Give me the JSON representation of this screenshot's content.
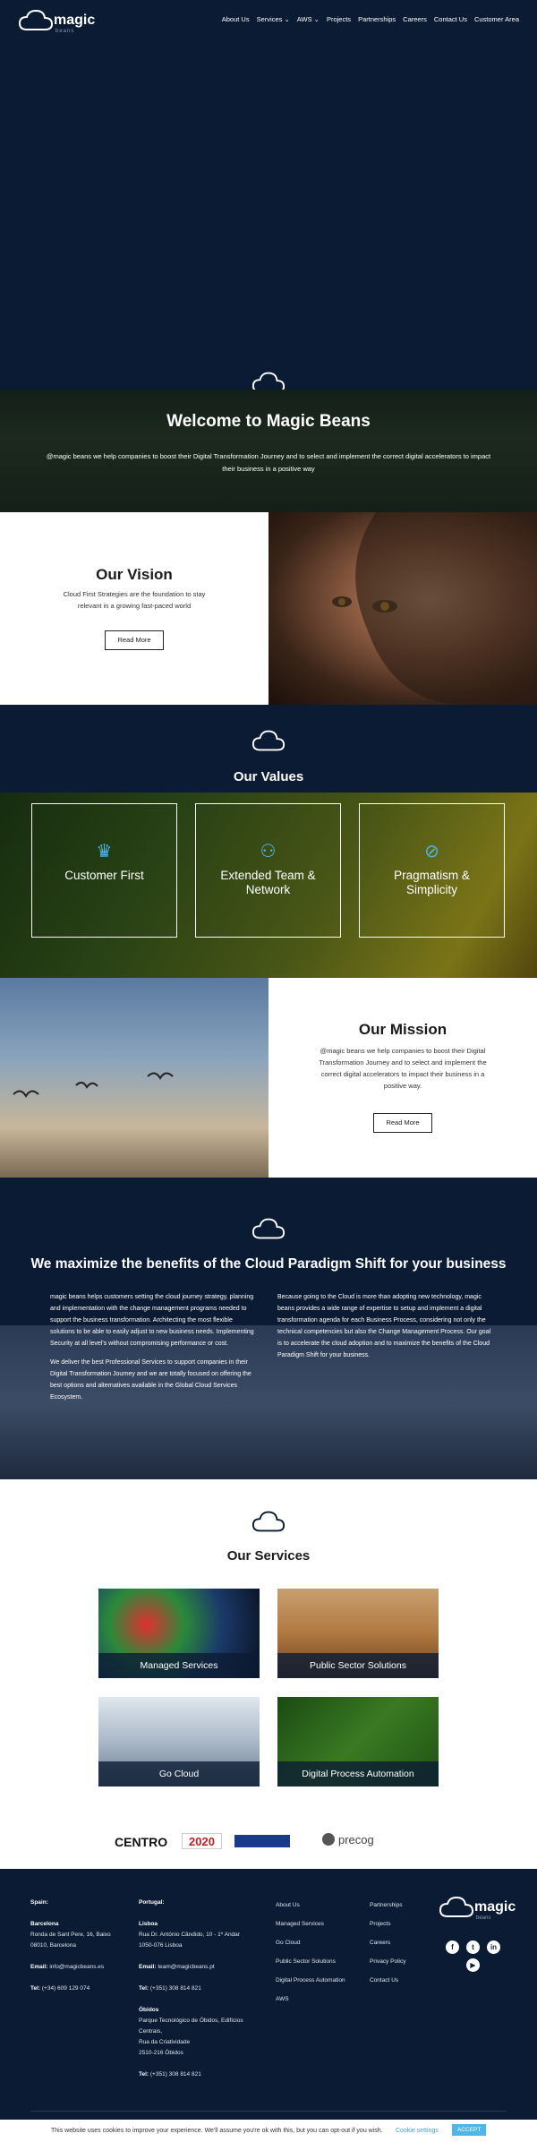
{
  "header": {
    "logo_word": "magic",
    "logo_sub": "beans",
    "nav": [
      "About Us",
      "Services",
      "AWS",
      "Projects",
      "Partnerships",
      "Careers",
      "Contact Us",
      "Customer Area"
    ]
  },
  "welcome": {
    "title": "Welcome to Magic Beans",
    "text": "@magic beans we help companies to boost their Digital Transformation Journey and to select and implement the correct digital accelerators to impact their business in a positive way"
  },
  "vision": {
    "title": "Our Vision",
    "text": "Cloud First Strategies are the foundation to stay relevant in a growing fast-paced world",
    "button": "Read More"
  },
  "values": {
    "title": "Our Values",
    "items": [
      {
        "label": "Customer First",
        "icon": "crown-icon"
      },
      {
        "label": "Extended Team & Network",
        "icon": "users-icon"
      },
      {
        "label": "Pragmatism & Simplicity",
        "icon": "paperclip-icon"
      }
    ]
  },
  "mission": {
    "title": "Our Mission",
    "text": "@magic beans we help companies to boost their Digital Transformation Journey and to select and implement the correct digital accelerators to impact their business in a positive way.",
    "button": "Read More"
  },
  "paradigm": {
    "title": "We maximize the benefits of the Cloud Paradigm Shift for your business",
    "left_p1": "magic beans helps customers setting the cloud journey strategy, planning and implementation with the change management programs needed to support the business transformation. Architecting the most flexible solutions to be able to easily adjust to new business needs. Implementing Security at all level's without compromising performance or cost.",
    "left_p2": "We deliver the best Professional Services to support companies in their Digital Transformation Journey and we are totally focused on offering the best options and alternatives available in the Global Cloud Services Ecosystem.",
    "right_p1": "Because going to the Cloud is more than adopting new technology, magic beans provides a wide range of expertise to setup and implement a digital transformation agenda for each Business Process, considering not only the technical competencies but also the Change Management Process. Our goal is to accelerate the cloud adoption and to maximize the benefits of the Cloud Paradigm Shift for your business."
  },
  "services": {
    "title": "Our Services",
    "items": [
      "Managed Services",
      "Public Sector Solutions",
      "Go Cloud",
      "Digital Process Automation"
    ]
  },
  "logos": [
    "CENTRO",
    "2020",
    "precog"
  ],
  "footer": {
    "spain_title": "Spain:",
    "spain_city": "Barcelona",
    "spain_addr1": "Ronda de Sant Pere, 16, Baixo",
    "spain_addr2": "08010, Barcelona",
    "spain_email_label": "Email:",
    "spain_email": "info@magicbeans.es",
    "spain_tel_label": "Tel:",
    "spain_tel": "(+34) 609 129 074",
    "pt_title": "Portugal:",
    "pt_city1": "Lisboa",
    "pt_addr1": "Rua Dr. António Cândido, 10 - 1º Andar",
    "pt_addr2": "1050-076 Lisboa",
    "pt_email_label": "Email:",
    "pt_email": "team@magicbeans.pt",
    "pt_tel_label": "Tel:",
    "pt_tel1": "(+351) 308 814 821",
    "pt_city2": "Óbidos",
    "pt_addr3": "Parque Tecnológico de Óbidos, Edifícios Centrais,",
    "pt_addr4": "Rua da Criatividade",
    "pt_addr5": "2510-216 Óbidos",
    "pt_tel2": "(+351) 308 814 821",
    "links1": [
      "About Us",
      "Managed Services",
      "Go Cloud",
      "Public Sector Solutions",
      "Digital Process Automation",
      "AWS"
    ],
    "links2": [
      "Partnerships",
      "Projects",
      "Careers",
      "Privacy Policy",
      "Contact Us"
    ]
  },
  "cookie": {
    "text": "This website uses cookies to improve your experience. We'll assume you're ok with this, but you can opt-out if you wish.",
    "settings": "Cookie settings",
    "accept": "ACCEPT"
  },
  "colors": {
    "navy": "#0b1b33",
    "accent": "#4fb6e8"
  }
}
